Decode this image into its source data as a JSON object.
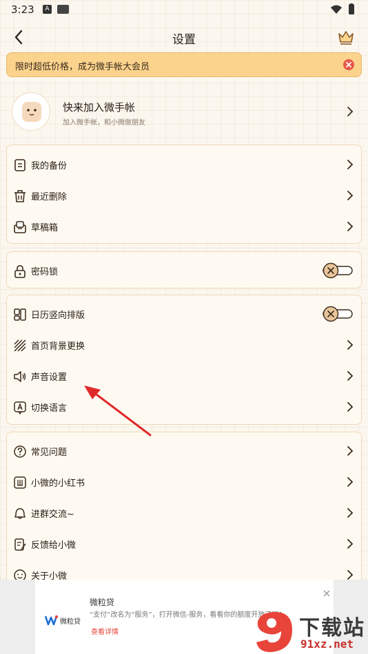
{
  "status_bar": {
    "time": "3:23",
    "icon_a": "A"
  },
  "header": {
    "title": "设置"
  },
  "promo": {
    "text": "限时超低价格，成为微手帐大会员"
  },
  "profile": {
    "title": "快来加入微手帐",
    "subtitle": "加入微手帐，和小微做朋友"
  },
  "groups": {
    "backup": [
      {
        "label": "我的备份",
        "icon": "backup-icon"
      },
      {
        "label": "最近删除",
        "icon": "trash-icon"
      },
      {
        "label": "草稿箱",
        "icon": "drafts-icon"
      }
    ],
    "security": [
      {
        "label": "密码锁",
        "icon": "lock-icon",
        "toggle": "off"
      }
    ],
    "display": [
      {
        "label": "日历竖向排版",
        "icon": "calendar-layout-icon",
        "toggle": "off"
      },
      {
        "label": "首页背景更换",
        "icon": "background-icon"
      },
      {
        "label": "声音设置",
        "icon": "sound-icon"
      },
      {
        "label": "切换语言",
        "icon": "language-icon"
      }
    ],
    "help": [
      {
        "label": "常见问题",
        "icon": "question-icon"
      },
      {
        "label": "小微的小红书",
        "icon": "redbook-icon"
      },
      {
        "label": "进群交流~",
        "icon": "group-chat-icon"
      },
      {
        "label": "反馈给小微",
        "icon": "feedback-icon"
      },
      {
        "label": "关于小微",
        "icon": "about-icon"
      }
    ]
  },
  "ad": {
    "brand": "微粒贷",
    "title": "微粒贷",
    "desc": "“支付”改名为“服务”，打开微信-服务，看看你的额度开放了吗?",
    "link": "查看详情"
  },
  "watermark": {
    "text": "下载站",
    "url": "91xz.net"
  },
  "colors": {
    "accent": "#e3c79a",
    "promo_bg": "#fbd38d",
    "close_red": "#e8584a",
    "text": "#2a2018"
  }
}
